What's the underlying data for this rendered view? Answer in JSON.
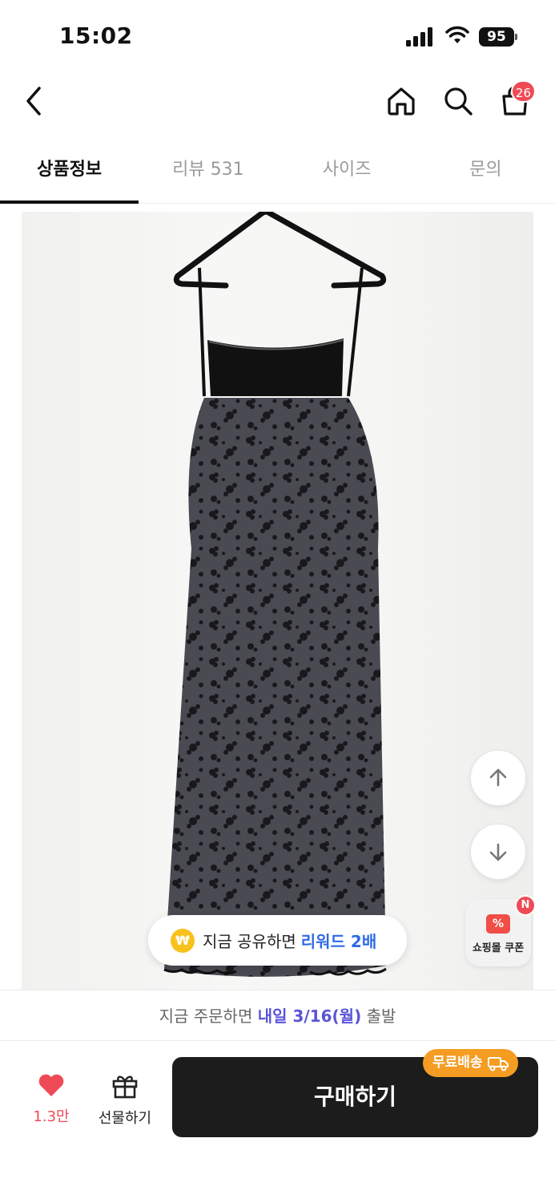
{
  "status_bar": {
    "time": "15:02",
    "battery": "95"
  },
  "nav": {
    "back_icon": "chevron-left-icon",
    "home_icon": "home-icon",
    "search_icon": "search-icon",
    "cart_icon": "shopping-bag-icon",
    "cart_count": "26"
  },
  "tabs": [
    {
      "label": "상품정보",
      "active": true
    },
    {
      "label": "리뷰 531",
      "active": false
    },
    {
      "label": "사이즈",
      "active": false
    },
    {
      "label": "문의",
      "active": false
    }
  ],
  "floating": {
    "scroll_up_icon": "arrow-up-icon",
    "scroll_down_icon": "arrow-down-icon",
    "coupon_label": "쇼핑몰 쿠폰",
    "coupon_badge": "N"
  },
  "share": {
    "won_symbol": "₩",
    "text": "지금 공유하면",
    "highlight": "리워드 2배"
  },
  "delivery": {
    "prefix": "지금 주문하면",
    "date": "내일 3/16(월)",
    "suffix": "출발"
  },
  "bottom": {
    "like_count": "1.3만",
    "gift_label": "선물하기",
    "buy_label": "구매하기",
    "free_shipping": "무료배송"
  },
  "colors": {
    "accent_red": "#ef4b57",
    "delivery_purple": "#5a54d8",
    "share_blue": "#2e6be6",
    "free_ship_orange": "#f59c22"
  }
}
